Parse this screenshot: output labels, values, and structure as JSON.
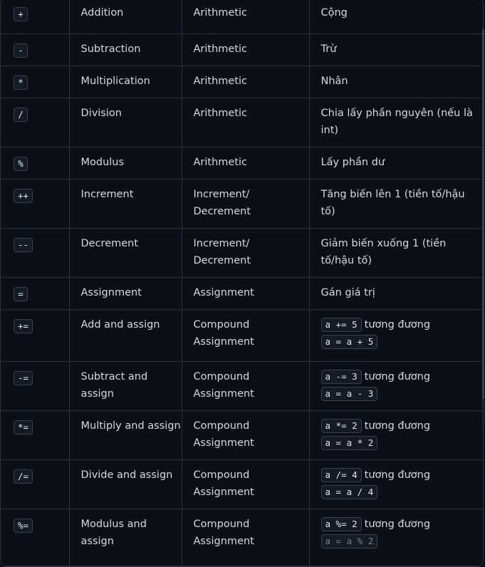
{
  "rows": [
    {
      "op": "+",
      "name": "Addition",
      "type": "Arithmetic",
      "desc": "Cộng"
    },
    {
      "op": "-",
      "name": "Subtraction",
      "type": "Arithmetic",
      "desc": "Trừ"
    },
    {
      "op": "*",
      "name": "Multiplication",
      "type": "Arithmetic",
      "desc": "Nhân"
    },
    {
      "op": "/",
      "name": "Division",
      "type": "Arithmetic",
      "desc": "Chia lấy phần nguyên (nếu là int)"
    },
    {
      "op": "%",
      "name": "Modulus",
      "type": "Arithmetic",
      "desc": "Lấy phần dư"
    },
    {
      "op": "++",
      "name": "Increment",
      "type": "Increment/ Decrement",
      "desc": "Tăng biến lên 1 (tiền tố/hậu tố)"
    },
    {
      "op": "--",
      "name": "Decrement",
      "type": "Increment/ Decrement",
      "desc": "Giảm biến xuống 1 (tiền tố/hậu tố)"
    },
    {
      "op": "=",
      "name": "Assignment",
      "type": "Assignment",
      "desc": "Gán giá trị"
    },
    {
      "op": "+=",
      "name": "Add and assign",
      "type": "Compound Assignment",
      "ex": "a += 5",
      "eq": "a = a + 5",
      "mid": "tương đương"
    },
    {
      "op": "-=",
      "name": "Subtract and assign",
      "type": "Compound Assignment",
      "ex": "a -= 3",
      "eq": "a = a - 3",
      "mid": "tương đương"
    },
    {
      "op": "*=",
      "name": "Multiply and assign",
      "type": "Compound Assignment",
      "ex": "a *= 2",
      "eq": "a = a * 2",
      "mid": "tương đương"
    },
    {
      "op": "/=",
      "name": "Divide and assign",
      "type": "Compound Assignment",
      "ex": "a /= 4",
      "eq": "a = a / 4",
      "mid": "tương đương"
    },
    {
      "op": "%=",
      "name": "Modulus and assign",
      "type": "Compound Assignment",
      "ex": "a %= 2",
      "eq": "a = a % 2",
      "mid": "tương đương"
    }
  ]
}
